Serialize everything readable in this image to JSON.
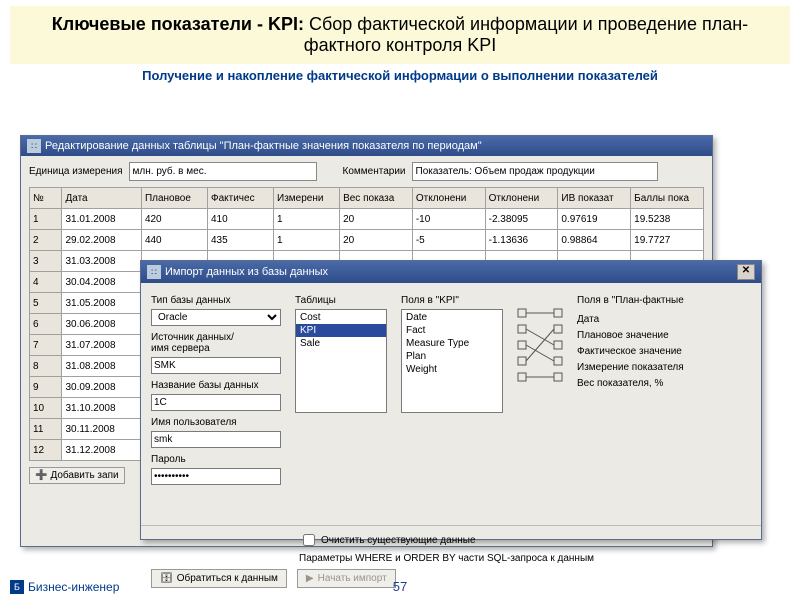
{
  "slide": {
    "title_bold": "Ключевые показатели - KPI:",
    "title_rest": " Сбор фактической информации и проведение план-фактного контроля KPI",
    "subtitle": "Получение и накопление фактической информации о выполнении показателей",
    "page": "57",
    "footer": "Бизнес-инженер"
  },
  "win1": {
    "title": "Редактирование данных таблицы  \"План-фактные значения показателя по периодам\"",
    "unit_label": "Единица измерения",
    "unit_value": "млн. руб. в мес.",
    "comment_label": "Комментарии",
    "comment_value": "Показатель: Объем продаж продукции",
    "cols": [
      "№",
      "Дата",
      "Плановое",
      "Фактичес",
      "Измерени",
      "Вес показа",
      "Отклонени",
      "Отклонени",
      "ИВ показат",
      "Баллы пока"
    ],
    "rows": [
      [
        "1",
        "31.01.2008",
        "420",
        "410",
        "1",
        "20",
        "-10",
        "-2.38095",
        "0.97619",
        "19.5238"
      ],
      [
        "2",
        "29.02.2008",
        "440",
        "435",
        "1",
        "20",
        "-5",
        "-1.13636",
        "0.98864",
        "19.7727"
      ],
      [
        "3",
        "31.03.2008",
        "",
        "",
        "",
        "",
        "",
        "",
        "",
        ""
      ],
      [
        "4",
        "30.04.2008",
        "",
        "",
        "",
        "",
        "",
        "",
        "",
        ""
      ],
      [
        "5",
        "31.05.2008",
        "",
        "",
        "",
        "",
        "",
        "",
        "",
        ""
      ],
      [
        "6",
        "30.06.2008",
        "",
        "",
        "",
        "",
        "",
        "",
        "",
        ""
      ],
      [
        "7",
        "31.07.2008",
        "",
        "",
        "",
        "",
        "",
        "",
        "",
        ""
      ],
      [
        "8",
        "31.08.2008",
        "",
        "",
        "",
        "",
        "",
        "",
        "",
        ""
      ],
      [
        "9",
        "30.09.2008",
        "",
        "",
        "",
        "",
        "",
        "",
        "",
        ""
      ],
      [
        "10",
        "31.10.2008",
        "",
        "",
        "",
        "",
        "",
        "",
        "",
        ""
      ],
      [
        "11",
        "30.11.2008",
        "",
        "",
        "",
        "",
        "",
        "",
        "",
        ""
      ],
      [
        "12",
        "31.12.2008",
        "",
        "",
        "",
        "",
        "",
        "",
        "",
        ""
      ]
    ],
    "add_btn": "Добавить запи"
  },
  "win2": {
    "title": "Импорт данных из базы данных",
    "dbtype_label": "Тип базы данных",
    "dbtype_value": "Oracle",
    "src_label": "Источник данных/\nимя сервера",
    "src_value": "SMK",
    "dbname_label": "Название базы данных",
    "dbname_value": "1C",
    "user_label": "Имя пользователя",
    "user_value": "smk",
    "pass_label": "Пароль",
    "pass_value": "**********",
    "tables_label": "Таблицы",
    "tables": [
      "Cost",
      "KPI",
      "Sale"
    ],
    "tables_sel": "KPI",
    "fields_label": "Поля в \"KPI\"",
    "fields": [
      "Date",
      "Fact",
      "Measure Type",
      "Plan",
      "Weight"
    ],
    "target_label": "Поля в  \"План-фактные",
    "targets": [
      "Дата",
      "Плановое значение",
      "Фактическое значение",
      "Измерение показателя",
      "Вес показателя, %"
    ],
    "clear_label": "Очистить существующие данные",
    "where_label": "Параметры WHERE и ORDER BY части SQL-запроса к данным",
    "connect_btn": "Обратиться к данным",
    "import_btn": "Начать импорт"
  }
}
